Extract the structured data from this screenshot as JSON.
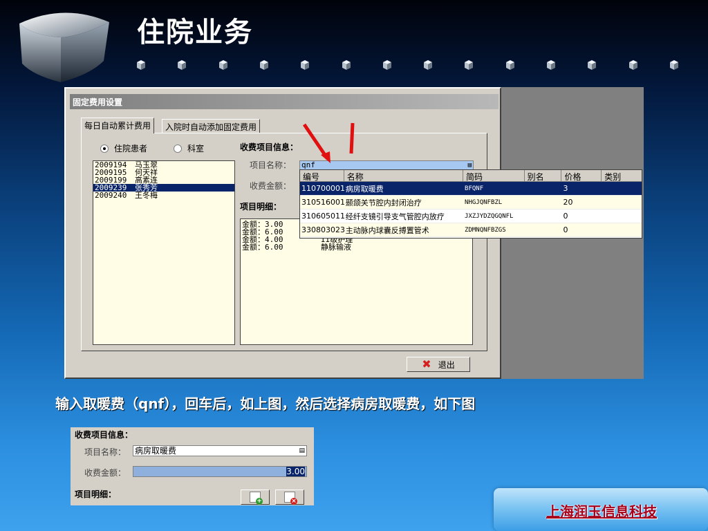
{
  "slide": {
    "title": "住院业务",
    "caption": "输入取暖费（qnf），回车后，如上图，然后选择病房取暖费，如下图",
    "company": "上海润玉信息科技"
  },
  "dialog": {
    "title": "固定费用设置",
    "tabs": [
      "每日自动累计费用",
      "入院时自动添加固定费用"
    ],
    "radio_patient": "住院患者",
    "radio_dept": "科室",
    "fee_info_label": "收费项目信息：",
    "item_name_label": "项目名称：",
    "item_name_value": "qnf",
    "amount_label": "收费金额：",
    "detail_label": "项目明细：",
    "exit_label": "退出",
    "patients": [
      {
        "id": "2009194",
        "name": "马玉翠"
      },
      {
        "id": "2009195",
        "name": "何天祥"
      },
      {
        "id": "2009199",
        "name": "高素连"
      },
      {
        "id": "2009239",
        "name": "张秀芳"
      },
      {
        "id": "2009240",
        "name": "王冬梅"
      }
    ],
    "selected_patient": 3,
    "details": [
      {
        "amount": "金额：3.00",
        "name": ""
      },
      {
        "amount": "金额：6.00",
        "name": ""
      },
      {
        "amount": "金额：4.00",
        "name": "II级护理"
      },
      {
        "amount": "金额：6.00",
        "name": "静脉输液"
      }
    ]
  },
  "dropdown": {
    "headers": [
      "编号",
      "名称",
      "简码",
      "别名",
      "价格",
      "类别"
    ],
    "rows": [
      {
        "code": "110700001",
        "name": "病房取暖费",
        "short": "BFQNF",
        "alias": "",
        "price": "3",
        "category": ""
      },
      {
        "code": "310516001",
        "name": "颞颌关节腔内封闭治疗",
        "short": "NHGJQNFBZL",
        "alias": "",
        "price": "20",
        "category": ""
      },
      {
        "code": "310605011",
        "name": "经纤支镜引导支气管腔内放疗",
        "short": "JXZJYDZQGQNFL",
        "alias": "",
        "price": "0",
        "category": ""
      },
      {
        "code": "330803023",
        "name": "主动脉内球囊反搏置管术",
        "short": "ZDMNQNFBZGS",
        "alias": "",
        "price": "0",
        "category": ""
      }
    ],
    "selected_row": 0
  },
  "snippet": {
    "fee_info_label": "收费项目信息：",
    "item_name_label": "项目名称：",
    "item_name_value": "病房取暖费",
    "amount_label": "收费金额：",
    "amount_value": "3.00",
    "detail_label": "项目明细："
  },
  "colors": {
    "selection": "#0a246a",
    "company_text": "#a8001a",
    "arrow": "#e01010"
  }
}
